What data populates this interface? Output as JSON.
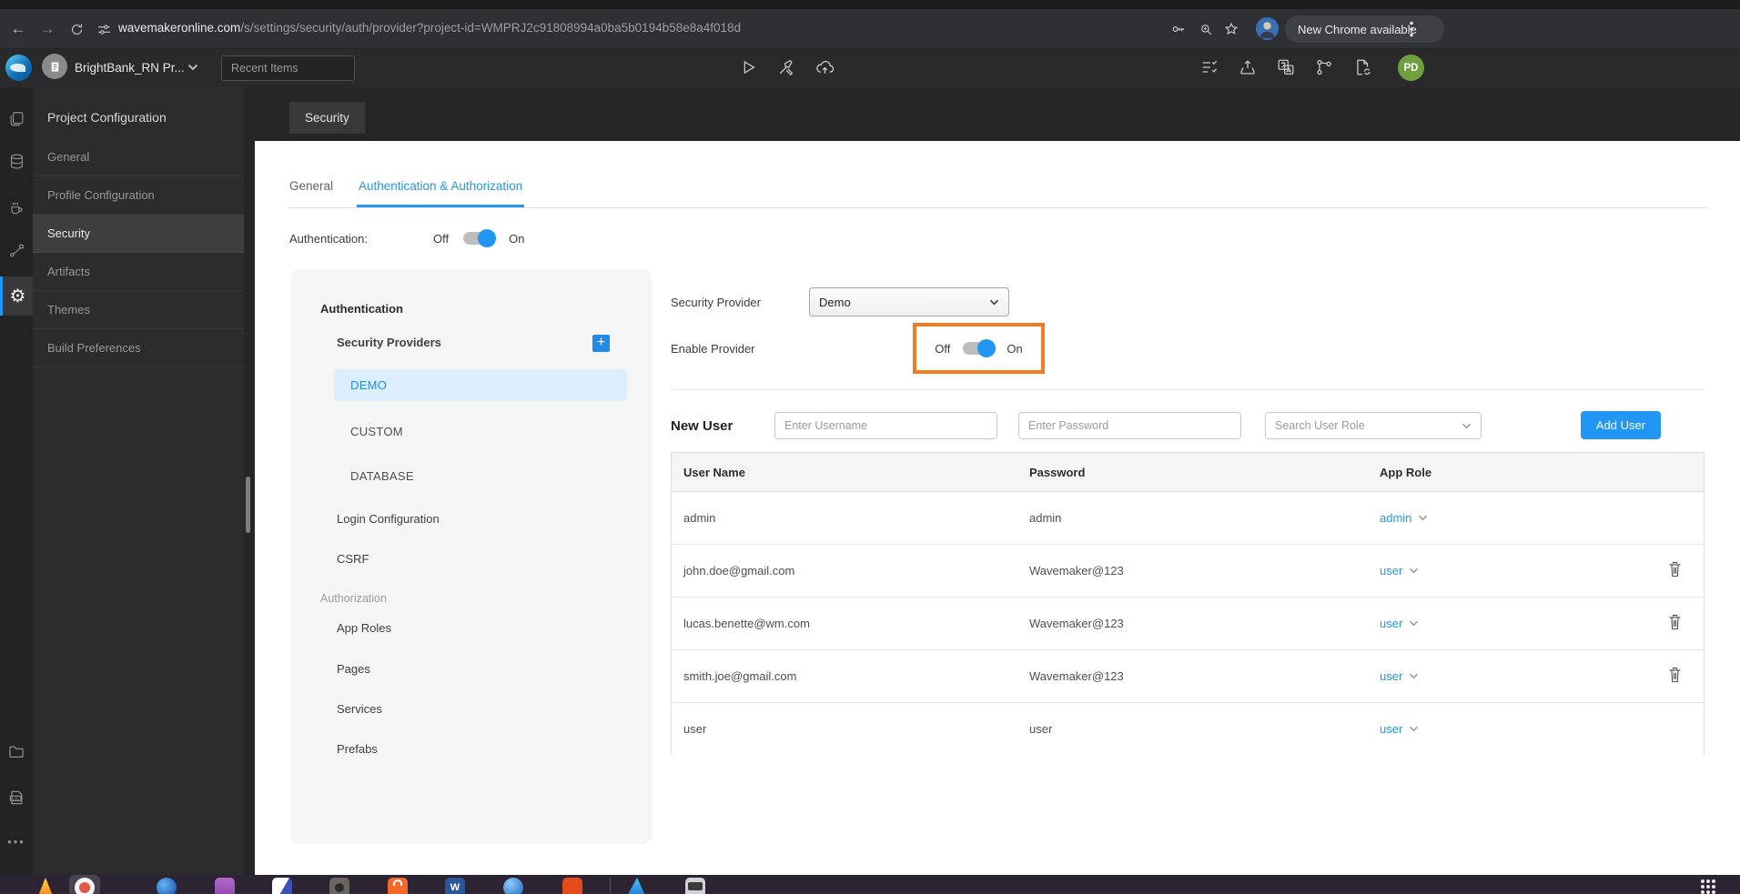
{
  "browser": {
    "url": {
      "domain": "wavemakeronline.com",
      "path": "/s/settings/security/auth/provider?project-id=WMPRJ2c91808994a0ba5b0194b58e8a4f018d"
    },
    "update_button": "New Chrome available",
    "icons": [
      "back-arrow",
      "forward-arrow",
      "reload",
      "site-settings",
      "password-key",
      "zoom-search",
      "bookmark-star",
      "profile-avatar",
      "menu-dots"
    ]
  },
  "header": {
    "project_name": "BrightBank_RN Pr...",
    "recent_items": "Recent Items",
    "user_initials": "PD",
    "icons": [
      "run-play",
      "dev-tools",
      "cloud-push",
      "checklist",
      "export-app",
      "translate",
      "version-branch",
      "file-sync"
    ]
  },
  "sidebar": {
    "title": "Project Configuration",
    "items": [
      {
        "label": "General",
        "selected": false
      },
      {
        "label": "Profile Configuration",
        "selected": false
      },
      {
        "label": "Security",
        "selected": true
      },
      {
        "label": "Artifacts",
        "selected": false
      },
      {
        "label": "Themes",
        "selected": false
      },
      {
        "label": "Build Preferences",
        "selected": false
      }
    ],
    "rail_icons": [
      "pages",
      "database",
      "java-services",
      "apis-connector",
      "settings-gear",
      "folder",
      "log-file",
      "more-dots"
    ]
  },
  "main": {
    "page_tab": "Security",
    "tabs": [
      {
        "label": "General",
        "active": false
      },
      {
        "label": "Authentication & Authorization",
        "active": true
      }
    ],
    "auth_toggle": {
      "label": "Authentication:",
      "off": "Off",
      "on": "On",
      "state": "on"
    },
    "nav": {
      "auth_section": "Authentication",
      "providers_heading": "Security Providers",
      "providers": [
        {
          "label": "DEMO",
          "selected": true
        },
        {
          "label": "CUSTOM",
          "selected": false
        },
        {
          "label": "DATABASE",
          "selected": false
        }
      ],
      "login_config": "Login Configuration",
      "csrf": "CSRF",
      "authz_section": "Authorization",
      "authz_items": [
        "App Roles",
        "Pages",
        "Services",
        "Prefabs"
      ]
    },
    "form": {
      "provider_label": "Security Provider",
      "provider_value": "Demo",
      "enable_label": "Enable Provider",
      "off": "Off",
      "on": "On",
      "enabled": true
    },
    "new_user": {
      "label": "New User",
      "username_placeholder": "Enter Username",
      "password_placeholder": "Enter Password",
      "role_placeholder": "Search User Role",
      "add_button": "Add User"
    },
    "table": {
      "headers": [
        "User Name",
        "Password",
        "App Role"
      ],
      "rows": [
        {
          "username": "admin",
          "password": "admin",
          "role": "admin",
          "deletable": false
        },
        {
          "username": "john.doe@gmail.com",
          "password": "Wavemaker@123",
          "role": "user",
          "deletable": true
        },
        {
          "username": "lucas.benette@wm.com",
          "password": "Wavemaker@123",
          "role": "user",
          "deletable": true
        },
        {
          "username": "smith.joe@gmail.com",
          "password": "Wavemaker@123",
          "role": "user",
          "deletable": true
        },
        {
          "username": "user",
          "password": "user",
          "role": "user",
          "deletable": false
        }
      ]
    }
  },
  "colors": {
    "accent_blue": "#2196f3",
    "annotation_orange": "#f47b20",
    "selected_provider_bg": "#dcedfb",
    "dark_bg": "#262626",
    "avatar_green": "#6f9f3f"
  }
}
